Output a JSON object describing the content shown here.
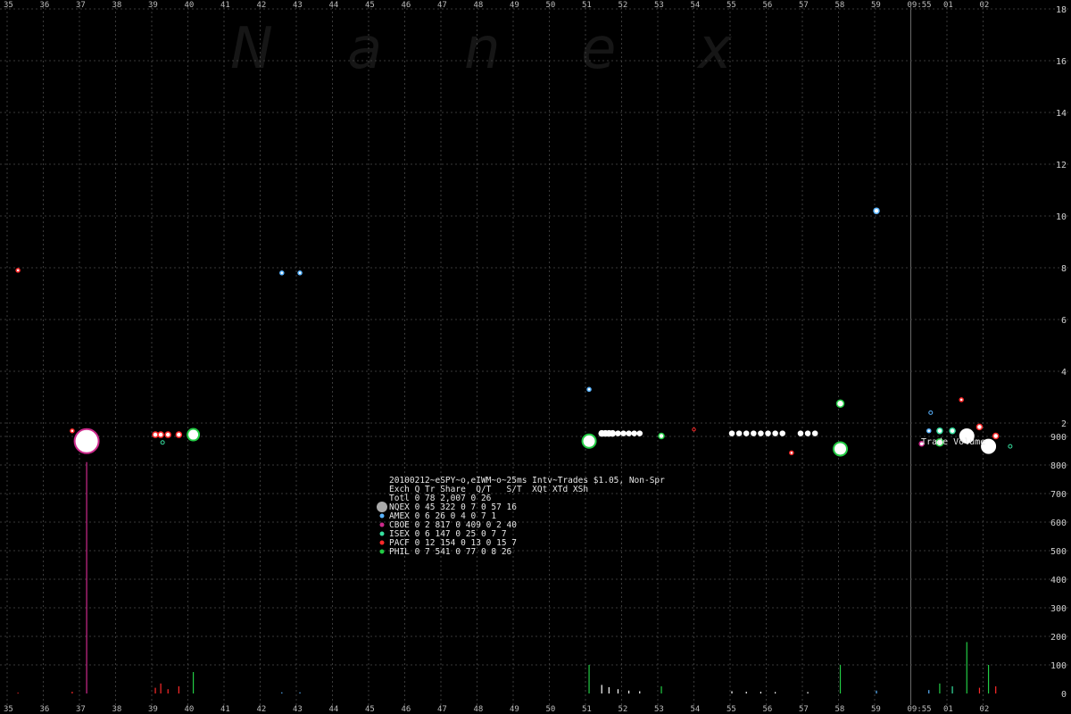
{
  "watermark": [
    "N",
    "a",
    "n",
    "e",
    "x"
  ],
  "colors": {
    "background": "#000000",
    "grid": "#4a4a4a",
    "NQEX": "#ffffff",
    "AMEX": "#5ab4ff",
    "CBOE": "#cc2a8c",
    "ISEX": "#36e0a0",
    "PACF": "#ff2a2a",
    "PHIL": "#22cc44",
    "legend_totl": "#aaaaaa"
  },
  "legend": {
    "title": "20100212~eSPY~o,eIWM~o~25ms Intv~Trades $1.05, Non-Spr",
    "header": "Exch Q Tr Share  Q/T   S/T  XQt XTd XSh",
    "rows": [
      {
        "exch": "Totl",
        "text": "Totl 0 78 2,007    0    26",
        "color": "#aaaaaa"
      },
      {
        "exch": "NQEX",
        "text": "NQEX 0 45   322    0     7   0  57  16",
        "color": "#ffffff"
      },
      {
        "exch": "AMEX",
        "text": "AMEX 0  6    26    0     4   0   7   1",
        "color": "#5ab4ff"
      },
      {
        "exch": "CBOE",
        "text": "CBOE 0  2   817    0   409   0   2  40",
        "color": "#cc2a8c"
      },
      {
        "exch": "ISEX",
        "text": "ISEX 0  6   147    0    25   0   7   7",
        "color": "#36e0a0"
      },
      {
        "exch": "PACF",
        "text": "PACF 0 12   154    0    13   0  15   7",
        "color": "#ff2a2a"
      },
      {
        "exch": "PHIL",
        "text": "PHIL 0  7   541    0    77   0   8  26",
        "color": "#22cc44"
      }
    ]
  },
  "chart_data": {
    "type": "scatter",
    "x_ticks": [
      "35",
      "36",
      "37",
      "38",
      "39",
      "40",
      "41",
      "42",
      "43",
      "44",
      "45",
      "46",
      "47",
      "48",
      "49",
      "50",
      "51",
      "52",
      "53",
      "54",
      "55",
      "56",
      "57",
      "58",
      "59",
      "09:55",
      "01",
      "02"
    ],
    "price_axis": {
      "ticks": [
        "2",
        "4",
        "6",
        "8",
        "10",
        "12",
        "14",
        "16",
        "18"
      ],
      "ylim": [
        0,
        18
      ]
    },
    "volume_axis": {
      "ticks": [
        "0",
        "100",
        "200",
        "300",
        "400",
        "500",
        "600",
        "700",
        "800",
        "900"
      ],
      "ylim": [
        0,
        900
      ]
    },
    "volume_label": "Trade Volume",
    "trades": [
      {
        "x": 35.3,
        "y": 7.9,
        "exch": "PACF",
        "size": 2
      },
      {
        "x": 36.8,
        "y": 1.7,
        "exch": "PACF",
        "size": 2
      },
      {
        "x": 37.2,
        "y": 1.3,
        "exch": "CBOE",
        "size": 12
      },
      {
        "x": 39.1,
        "y": 1.55,
        "exch": "PACF",
        "size": 3
      },
      {
        "x": 39.25,
        "y": 1.55,
        "exch": "PACF",
        "size": 3
      },
      {
        "x": 39.45,
        "y": 1.55,
        "exch": "PACF",
        "size": 3
      },
      {
        "x": 39.75,
        "y": 1.55,
        "exch": "PACF",
        "size": 3
      },
      {
        "x": 39.3,
        "y": 1.25,
        "exch": "ISEX",
        "size": 1.5
      },
      {
        "x": 40.15,
        "y": 1.55,
        "exch": "PHIL",
        "size": 5
      },
      {
        "x": 42.6,
        "y": 7.8,
        "exch": "AMEX",
        "size": 2
      },
      {
        "x": 43.1,
        "y": 7.8,
        "exch": "AMEX",
        "size": 2
      },
      {
        "x": 51.1,
        "y": 3.3,
        "exch": "AMEX",
        "size": 2
      },
      {
        "x": 51.1,
        "y": 1.3,
        "exch": "PHIL",
        "size": 6
      },
      {
        "x": 51.45,
        "y": 1.6,
        "exch": "NQEX",
        "size": 3
      },
      {
        "x": 51.55,
        "y": 1.6,
        "exch": "NQEX",
        "size": 3
      },
      {
        "x": 51.65,
        "y": 1.6,
        "exch": "NQEX",
        "size": 3
      },
      {
        "x": 51.75,
        "y": 1.6,
        "exch": "NQEX",
        "size": 3
      },
      {
        "x": 51.9,
        "y": 1.6,
        "exch": "NQEX",
        "size": 2.5
      },
      {
        "x": 52.05,
        "y": 1.6,
        "exch": "NQEX",
        "size": 2.5
      },
      {
        "x": 52.2,
        "y": 1.6,
        "exch": "NQEX",
        "size": 2.5
      },
      {
        "x": 52.35,
        "y": 1.6,
        "exch": "NQEX",
        "size": 2.5
      },
      {
        "x": 52.5,
        "y": 1.6,
        "exch": "NQEX",
        "size": 2.5
      },
      {
        "x": 53.1,
        "y": 1.5,
        "exch": "PHIL",
        "size": 3
      },
      {
        "x": 54.0,
        "y": 1.75,
        "exch": "PACF",
        "size": 1.2
      },
      {
        "x": 55.05,
        "y": 1.6,
        "exch": "NQEX",
        "size": 2.5
      },
      {
        "x": 55.25,
        "y": 1.6,
        "exch": "NQEX",
        "size": 2.5
      },
      {
        "x": 55.45,
        "y": 1.6,
        "exch": "NQEX",
        "size": 2.5
      },
      {
        "x": 55.65,
        "y": 1.6,
        "exch": "NQEX",
        "size": 2.5
      },
      {
        "x": 55.85,
        "y": 1.6,
        "exch": "NQEX",
        "size": 2.5
      },
      {
        "x": 56.05,
        "y": 1.6,
        "exch": "NQEX",
        "size": 2.5
      },
      {
        "x": 56.25,
        "y": 1.6,
        "exch": "NQEX",
        "size": 2.5
      },
      {
        "x": 56.45,
        "y": 1.6,
        "exch": "NQEX",
        "size": 2.5
      },
      {
        "x": 56.95,
        "y": 1.6,
        "exch": "NQEX",
        "size": 2.5
      },
      {
        "x": 57.15,
        "y": 1.6,
        "exch": "NQEX",
        "size": 2.5
      },
      {
        "x": 57.35,
        "y": 1.6,
        "exch": "NQEX",
        "size": 2.5
      },
      {
        "x": 56.7,
        "y": 0.85,
        "exch": "PACF",
        "size": 2
      },
      {
        "x": 58.05,
        "y": 2.75,
        "exch": "PHIL",
        "size": 4
      },
      {
        "x": 58.05,
        "y": 1.0,
        "exch": "PHIL",
        "size": 6
      },
      {
        "x": 59.05,
        "y": 10.2,
        "exch": "AMEX",
        "size": 3
      },
      {
        "x": 60.3,
        "y": 1.2,
        "exch": "CBOE",
        "size": 2.5
      },
      {
        "x": 60.55,
        "y": 2.4,
        "exch": "AMEX",
        "size": 1.5
      },
      {
        "x": 60.5,
        "y": 1.7,
        "exch": "AMEX",
        "size": 2
      },
      {
        "x": 60.8,
        "y": 1.7,
        "exch": "ISEX",
        "size": 3
      },
      {
        "x": 61.15,
        "y": 1.7,
        "exch": "ISEX",
        "size": 3
      },
      {
        "x": 60.8,
        "y": 1.25,
        "exch": "PHIL",
        "size": 4
      },
      {
        "x": 61.4,
        "y": 2.9,
        "exch": "PACF",
        "size": 2
      },
      {
        "x": 61.55,
        "y": 1.5,
        "exch": "NQEX",
        "size": 6
      },
      {
        "x": 61.9,
        "y": 1.85,
        "exch": "PACF",
        "size": 3
      },
      {
        "x": 62.15,
        "y": 1.1,
        "exch": "NQEX",
        "size": 6
      },
      {
        "x": 62.35,
        "y": 1.5,
        "exch": "PACF",
        "size": 3
      },
      {
        "x": 62.75,
        "y": 1.1,
        "exch": "ISEX",
        "size": 1.5
      }
    ],
    "volumes": [
      {
        "x": 35.3,
        "v": 3,
        "exch": "PACF"
      },
      {
        "x": 36.8,
        "v": 6,
        "exch": "PACF"
      },
      {
        "x": 37.2,
        "v": 810,
        "exch": "CBOE"
      },
      {
        "x": 39.1,
        "v": 20,
        "exch": "PACF"
      },
      {
        "x": 39.25,
        "v": 35,
        "exch": "PACF"
      },
      {
        "x": 39.45,
        "v": 15,
        "exch": "PACF"
      },
      {
        "x": 39.75,
        "v": 25,
        "exch": "PACF"
      },
      {
        "x": 40.15,
        "v": 75,
        "exch": "PHIL"
      },
      {
        "x": 42.6,
        "v": 4,
        "exch": "AMEX"
      },
      {
        "x": 43.1,
        "v": 4,
        "exch": "AMEX"
      },
      {
        "x": 51.1,
        "v": 100,
        "exch": "PHIL"
      },
      {
        "x": 51.45,
        "v": 30,
        "exch": "NQEX"
      },
      {
        "x": 51.65,
        "v": 22,
        "exch": "NQEX"
      },
      {
        "x": 51.9,
        "v": 15,
        "exch": "NQEX"
      },
      {
        "x": 52.2,
        "v": 10,
        "exch": "NQEX"
      },
      {
        "x": 52.5,
        "v": 8,
        "exch": "NQEX"
      },
      {
        "x": 53.1,
        "v": 25,
        "exch": "PHIL"
      },
      {
        "x": 55.05,
        "v": 8,
        "exch": "NQEX"
      },
      {
        "x": 55.45,
        "v": 6,
        "exch": "NQEX"
      },
      {
        "x": 55.85,
        "v": 6,
        "exch": "NQEX"
      },
      {
        "x": 56.25,
        "v": 5,
        "exch": "NQEX"
      },
      {
        "x": 57.15,
        "v": 5,
        "exch": "NQEX"
      },
      {
        "x": 58.05,
        "v": 100,
        "exch": "PHIL"
      },
      {
        "x": 59.05,
        "v": 10,
        "exch": "AMEX"
      },
      {
        "x": 60.5,
        "v": 12,
        "exch": "AMEX"
      },
      {
        "x": 60.8,
        "v": 35,
        "exch": "PHIL"
      },
      {
        "x": 61.15,
        "v": 25,
        "exch": "ISEX"
      },
      {
        "x": 61.55,
        "v": 180,
        "exch": "PHIL"
      },
      {
        "x": 61.9,
        "v": 20,
        "exch": "PACF"
      },
      {
        "x": 62.15,
        "v": 100,
        "exch": "PHIL"
      },
      {
        "x": 62.35,
        "v": 25,
        "exch": "PACF"
      }
    ],
    "grid": true
  }
}
